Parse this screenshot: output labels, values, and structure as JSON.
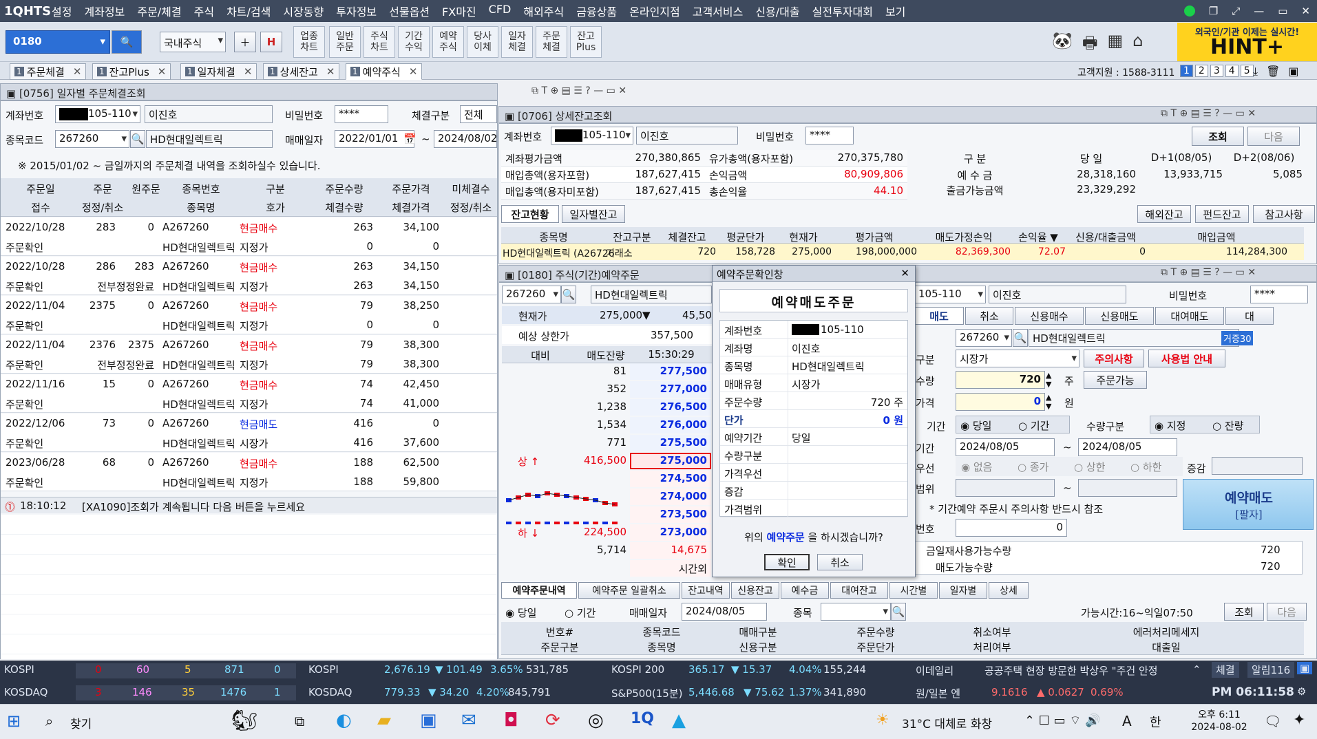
{
  "menubar": {
    "logo": "1QHTS",
    "items": [
      "설정",
      "계좌정보",
      "주문/체결",
      "주식",
      "차트/검색",
      "시장동향",
      "투자정보",
      "선물옵션",
      "FX마진",
      "CFD",
      "해외주식",
      "금융상품",
      "온라인지점",
      "고객서비스",
      "신용/대출",
      "실전투자대회",
      "보기"
    ]
  },
  "toolbar": {
    "code": "0180",
    "market": "국내주식",
    "buttons": [
      "업종\n차트",
      "일반\n주문",
      "주식\n차트",
      "기간\n수익",
      "예약\n주식",
      "당사\n이체",
      "일자\n체결",
      "주문\n체결",
      "잔고\nPlus"
    ],
    "banner_top": "외국인/기관 이제는 실시간!",
    "banner_main": "HINT+"
  },
  "tabs": [
    {
      "label": "주문체결"
    },
    {
      "label": "잔고Plus"
    },
    {
      "label": "일자체결"
    },
    {
      "label": "상세잔고"
    },
    {
      "label": "예약주식"
    }
  ],
  "tab_num": "1",
  "cs": "고객지원 : 1588-3111",
  "pages": [
    "1",
    "2",
    "3",
    "4",
    "5"
  ],
  "w756": {
    "title": "[0756] 일자별 주문체결조회",
    "acct_label": "계좌번호",
    "acct": "105-110",
    "name": "이진호",
    "pw_label": "비밀번호",
    "pw": "****",
    "type_label": "체결구분",
    "type": "전체",
    "code_label": "종목코드",
    "code": "267260",
    "stock": "HD현대일렉트릭",
    "date_label": "매매일자",
    "from": "2022/01/01",
    "to": "2024/08/02",
    "notice": "※ 2015/01/02 ~ 금일까지의 주문체결 내역을 조회하실수 있습니다.",
    "h1": [
      "주문일",
      "주문",
      "원주문",
      "종목번호",
      "구분",
      "주문수량",
      "주문가격",
      "미체결수"
    ],
    "h2": [
      "접수",
      "정정/취소",
      "",
      "종목명",
      "호가",
      "체결수량",
      "체결가격",
      "정정/취소"
    ],
    "rows": [
      {
        "date": "2022/10/28",
        "no": "283",
        "orig": "0",
        "code": "A267260",
        "side": "현금매수",
        "qty": "263",
        "price": "34,100",
        "st": "주문확인",
        "mod": "",
        "nm": "HD현대일렉트릭",
        "hoga": "지정가",
        "cq": "0",
        "cp": "0"
      },
      {
        "date": "2022/10/28",
        "no": "286",
        "orig": "283",
        "code": "A267260",
        "side": "현금매수",
        "qty": "263",
        "price": "34,150",
        "st": "주문확인",
        "mod": "전부정정완료",
        "nm": "HD현대일렉트릭",
        "hoga": "지정가",
        "cq": "263",
        "cp": "34,150"
      },
      {
        "date": "2022/11/04",
        "no": "2375",
        "orig": "0",
        "code": "A267260",
        "side": "현금매수",
        "qty": "79",
        "price": "38,250",
        "st": "주문확인",
        "mod": "",
        "nm": "HD현대일렉트릭",
        "hoga": "지정가",
        "cq": "0",
        "cp": "0"
      },
      {
        "date": "2022/11/04",
        "no": "2376",
        "orig": "2375",
        "code": "A267260",
        "side": "현금매수",
        "qty": "79",
        "price": "38,300",
        "st": "주문확인",
        "mod": "전부정정완료",
        "nm": "HD현대일렉트릭",
        "hoga": "지정가",
        "cq": "79",
        "cp": "38,300"
      },
      {
        "date": "2022/11/16",
        "no": "15",
        "orig": "0",
        "code": "A267260",
        "side": "현금매수",
        "qty": "74",
        "price": "42,450",
        "st": "주문확인",
        "mod": "",
        "nm": "HD현대일렉트릭",
        "hoga": "지정가",
        "cq": "74",
        "cp": "41,000"
      },
      {
        "date": "2022/12/06",
        "no": "73",
        "orig": "0",
        "code": "A267260",
        "side": "현금매도",
        "qty": "416",
        "price": "0",
        "st": "주문확인",
        "mod": "",
        "nm": "HD현대일렉트릭",
        "hoga": "시장가",
        "cq": "416",
        "cp": "37,600"
      },
      {
        "date": "2023/06/28",
        "no": "68",
        "orig": "0",
        "code": "A267260",
        "side": "현금매수",
        "qty": "188",
        "price": "62,500",
        "st": "주문확인",
        "mod": "",
        "nm": "HD현대일렉트릭",
        "hoga": "지정가",
        "cq": "188",
        "cp": "59,800"
      }
    ],
    "msg_time": "18:10:12",
    "msg": "[XA1090]조회가 계속됩니다  다음 버튼을 누르세요"
  },
  "w706": {
    "title": "[0706] 상세잔고조회",
    "acct_label": "계좌번호",
    "acct": "105-110",
    "name": "이진호",
    "pw_label": "비밀번호",
    "pw": "****",
    "query": "조회",
    "next": "다음",
    "s": [
      [
        "계좌평가금액",
        "270,380,865",
        "유가총액(용자포함)",
        "270,375,780"
      ],
      [
        "매입총액(용자포함)",
        "187,627,415",
        "손익금액",
        "80,909,806"
      ],
      [
        "매입총액(용자미포함)",
        "187,627,415",
        "총손익율",
        "44.10"
      ]
    ],
    "dh": [
      "구 분",
      "당 일",
      "D+1(08/05)",
      "D+2(08/06)"
    ],
    "d": [
      [
        "예 수 금",
        "28,318,160",
        "13,933,715",
        "5,085"
      ],
      [
        "출금가능금액",
        "23,329,292",
        "",
        ""
      ]
    ],
    "tabs": [
      "잔고현황",
      "일자별잔고"
    ],
    "btns": [
      "해외잔고",
      "펀드잔고",
      "참고사항"
    ],
    "gh": [
      "종목명",
      "잔고구분",
      "체결잔고",
      "평균단가",
      "현재가",
      "평가금액",
      "매도가정손익",
      "손익율 ▼",
      "신용/대출금액",
      "매입금액"
    ],
    "g": [
      "HD현대일렉트릭 (A26726",
      "거래소",
      "720",
      "158,728",
      "275,000",
      "198,000,000",
      "82,369,300",
      "72.07",
      "0",
      "114,284,300"
    ]
  },
  "w180": {
    "title": "[0180] 주식(기간)예약주문",
    "code": "267260",
    "stock": "HD현대일렉트릭",
    "cur_label": "현재가",
    "cur": "275,000",
    "cur_chg": "▼",
    "cur2": "45,50",
    "ul_label": "예상 상한가",
    "ul": "357,500",
    "hd": [
      "대비",
      "매도잔량",
      "15:30:29"
    ],
    "book": [
      [
        "",
        "81",
        "277,500"
      ],
      [
        "",
        "352",
        "277,000"
      ],
      [
        "",
        "1,238",
        "276,500"
      ],
      [
        "",
        "1,534",
        "276,000"
      ],
      [
        "",
        "771",
        "275,500"
      ],
      [
        "상 ↑",
        "416,500",
        "275,000"
      ],
      [
        "",
        "",
        "274,500"
      ],
      [
        "",
        "",
        "274,000"
      ],
      [
        "",
        "",
        "273,500"
      ],
      [
        "하 ↓",
        "224,500",
        "273,000"
      ],
      [
        "",
        "5,714",
        "14,675"
      ],
      [
        "",
        "",
        "시간외"
      ]
    ],
    "acct": "105-110",
    "name": "이진호",
    "pw_label": "비밀번호",
    "pw": "****",
    "otabs": [
      "매도",
      "취소",
      "신용매수",
      "신용매도",
      "대여매도",
      "대"
    ],
    "code2": "267260",
    "stock2": "HD현대일렉트릭",
    "badge": "거증30",
    "ptype": "시장가",
    "warn": "주의사항",
    "guide": "사용법 안내",
    "qty": "720",
    "unit_q": "주",
    "avail": "주문가능",
    "price": "0",
    "unit_p": "원",
    "period_label": "기간",
    "p1": "당일",
    "p2": "기간",
    "qtype": "수량구분",
    "q1": "지정",
    "q2": "잔량",
    "dfrom": "2024/08/05",
    "dto": "2024/08/05",
    "pr_opts": [
      "없음",
      "종가",
      "상한",
      "하한"
    ],
    "incr": "증감",
    "note": "* 기간예약 주문시 주의사항 반드시 참조",
    "pwd_val": "0",
    "order_btn": "예약매도",
    "order_sub": "[팔자]",
    "today_q_label": "금일재사용가능수량",
    "today_q": "720",
    "sell_q_label": "매도가능수량",
    "sell_q": "720",
    "btabs": [
      "예약주문내역",
      "예약주문 일괄취소",
      "잔고내역",
      "신용잔고",
      "예수금",
      "대여잔고",
      "시간별",
      "일자별",
      "상세"
    ],
    "bp1": "당일",
    "bp2": "기간",
    "bdate_label": "매매일자",
    "bdate": "2024/08/05",
    "bstk": "종목",
    "time_note": "가능시간:16~익일07:50",
    "bq": "조회",
    "bn": "다음",
    "bh1": [
      "번호#",
      "종목코드",
      "매매구분",
      "주문수량",
      "취소여부",
      "에러처리메세지"
    ],
    "bh2": [
      "주문구분",
      "종목명",
      "신용구분",
      "주문단가",
      "처리여부",
      "대출일"
    ]
  },
  "dialog": {
    "title": "예약주문확인창",
    "heading": "예약매도주문",
    "rows": [
      [
        "계좌번호",
        "105-110"
      ],
      [
        "계좌명",
        "이진호"
      ],
      [
        "종목명",
        "HD현대일렉트릭"
      ],
      [
        "매매유형",
        "시장가"
      ],
      [
        "주문수량",
        "720 주"
      ],
      [
        "단가",
        "0 원"
      ],
      [
        "예약기간",
        "당일"
      ],
      [
        "수량구분",
        ""
      ],
      [
        "가격우선",
        ""
      ],
      [
        "증감",
        ""
      ],
      [
        "가격범위",
        ""
      ]
    ],
    "q_pre": "위의 ",
    "q_hl": "예약주문",
    "q_post": " 을 하시겠습니까?",
    "ok": "확인",
    "cancel": "취소"
  },
  "status": {
    "r1": {
      "idx": "KOSPI",
      "a": "0",
      "b": "60",
      "c": "5",
      "d": "871",
      "e": "0",
      "idx2": "KOSPI",
      "v": "2,676.19",
      "ch": "▼ 101.49",
      "pct": "3.65%",
      "vol": "531,785",
      "idx3": "KOSPI 200",
      "v3": "365.17",
      "ch3": "▼ 15.37",
      "pct3": "4.04%",
      "vol3": "155,244",
      "news_src": "이데일리",
      "news": "공공주택 현장 방문한 박상우 \"주건 안정",
      "btn1": "체결",
      "btn2": "알림116"
    },
    "r2": {
      "idx": "KOSDAQ",
      "a": "3",
      "b": "146",
      "c": "35",
      "d": "1476",
      "e": "1",
      "idx2": "KOSDAQ",
      "v": "779.33",
      "ch": "▼ 34.20",
      "pct": "4.20%",
      "vol": "845,791",
      "idx3": "S&P500(15분)",
      "v3": "5,446.68",
      "ch3": "▼ 75.62",
      "pct3": "1.37%",
      "vol3": "341,890",
      "fx": "원/일본 엔",
      "fxv": "9.1616",
      "fxch": "▲ 0.0627",
      "fxp": "0.69%",
      "clock": "PM 06:11:58"
    }
  },
  "taskbar": {
    "search": "찾기",
    "weather": "31°C 대체로 화창",
    "ime": "A",
    "lang": "한",
    "time": "오후 6:11",
    "date": "2024-08-02"
  },
  "colors": {
    "menubar": "#3e4a5e",
    "accent": "#2c6fd6",
    "up": "#e8000f",
    "down": "#0a2be0"
  }
}
